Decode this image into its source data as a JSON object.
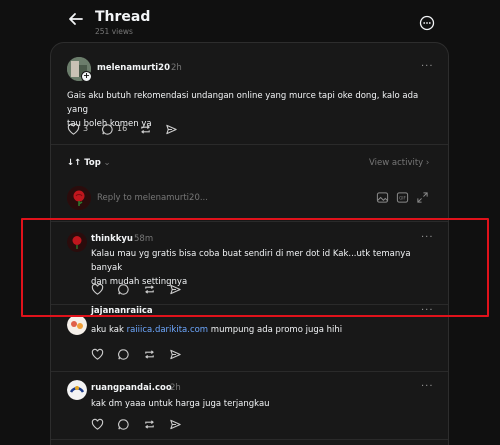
{
  "header": {
    "title": "Thread",
    "views": "251 views"
  },
  "op": {
    "username": "melenamurti20",
    "time": "2h",
    "text_line1": "Gais aku butuh rekomendasi undangan online yang murce tapi oke dong, kalo ada yang",
    "text_line2": "tau boleh komen ya",
    "likes": "3",
    "comments": "16"
  },
  "sort": {
    "label": "Top",
    "view_activity": "View activity"
  },
  "reply": {
    "placeholder": "Reply to melenamurti20..."
  },
  "comments": [
    {
      "username": "thinkkyu",
      "time": "58m",
      "line1": "Kalau mau yg gratis bisa coba buat sendiri di mer dot id Kak...utk temanya banyak",
      "line2": "dan mudah settingnya"
    },
    {
      "username": "jajananraiica",
      "time": "",
      "prefix": "aku kak ",
      "link": "raiiica.darikita.com",
      "suffix": " mumpung ada promo juga hihi"
    },
    {
      "username": "ruangpandai.coo",
      "time": "2h",
      "line1": "kak dm yaaa untuk harga juga terjangkau"
    }
  ],
  "colors": {
    "background": "#101010",
    "panel": "#181818",
    "highlight": "#e0121b",
    "link": "#6ea8ff"
  }
}
